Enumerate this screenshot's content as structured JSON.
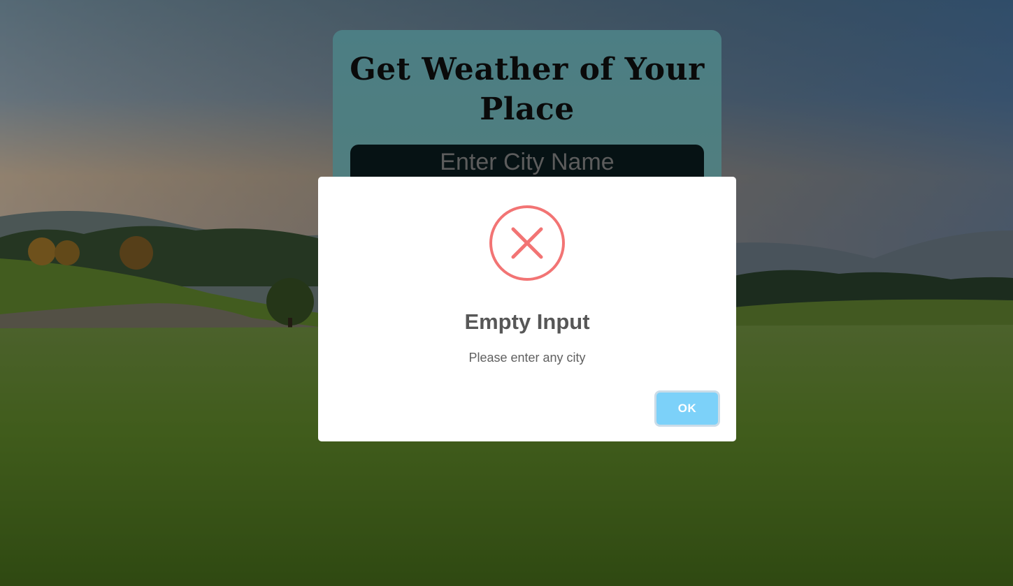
{
  "app": {
    "title": "Get Weather of Your Place"
  },
  "search": {
    "placeholder": "Enter City Name",
    "value": ""
  },
  "alert": {
    "icon": "error-x-icon",
    "title": "Empty Input",
    "message": "Please enter any city",
    "ok_label": "OK",
    "colors": {
      "icon": "#f27474",
      "button": "#7cd1f9"
    }
  }
}
